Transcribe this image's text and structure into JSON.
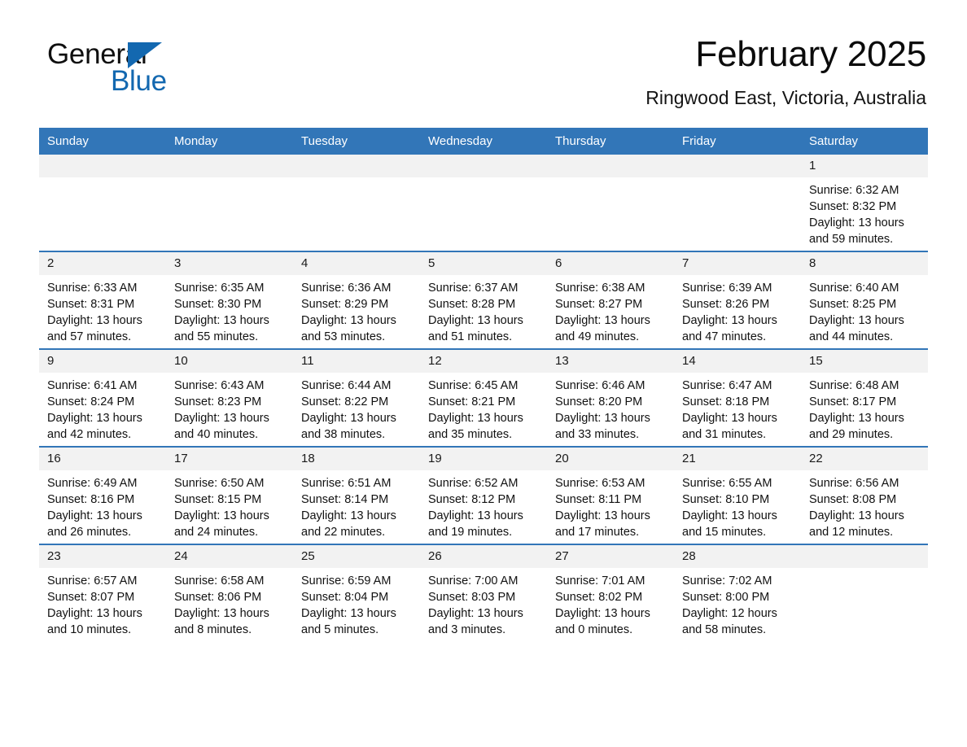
{
  "brand": {
    "name_line1": "General",
    "name_line2": "Blue",
    "colors": {
      "blue": "#1368b0",
      "black": "#0f0f0f"
    }
  },
  "header": {
    "title": "February 2025",
    "subtitle": "Ringwood East, Victoria, Australia"
  },
  "theme": {
    "header_blue": "#3276b8",
    "day_band_gray": "#f2f2f2",
    "row_rule_blue": "#3276b8",
    "text_black": "#111111",
    "page_background": "#ffffff"
  },
  "calendar": {
    "weekday_headers": [
      "Sunday",
      "Monday",
      "Tuesday",
      "Wednesday",
      "Thursday",
      "Friday",
      "Saturday"
    ],
    "weeks": [
      [
        {
          "day": "",
          "detail": ""
        },
        {
          "day": "",
          "detail": ""
        },
        {
          "day": "",
          "detail": ""
        },
        {
          "day": "",
          "detail": ""
        },
        {
          "day": "",
          "detail": ""
        },
        {
          "day": "",
          "detail": ""
        },
        {
          "day": "1",
          "detail": "Sunrise: 6:32 AM\nSunset: 8:32 PM\nDaylight: 13 hours and 59 minutes."
        }
      ],
      [
        {
          "day": "2",
          "detail": "Sunrise: 6:33 AM\nSunset: 8:31 PM\nDaylight: 13 hours and 57 minutes."
        },
        {
          "day": "3",
          "detail": "Sunrise: 6:35 AM\nSunset: 8:30 PM\nDaylight: 13 hours and 55 minutes."
        },
        {
          "day": "4",
          "detail": "Sunrise: 6:36 AM\nSunset: 8:29 PM\nDaylight: 13 hours and 53 minutes."
        },
        {
          "day": "5",
          "detail": "Sunrise: 6:37 AM\nSunset: 8:28 PM\nDaylight: 13 hours and 51 minutes."
        },
        {
          "day": "6",
          "detail": "Sunrise: 6:38 AM\nSunset: 8:27 PM\nDaylight: 13 hours and 49 minutes."
        },
        {
          "day": "7",
          "detail": "Sunrise: 6:39 AM\nSunset: 8:26 PM\nDaylight: 13 hours and 47 minutes."
        },
        {
          "day": "8",
          "detail": "Sunrise: 6:40 AM\nSunset: 8:25 PM\nDaylight: 13 hours and 44 minutes."
        }
      ],
      [
        {
          "day": "9",
          "detail": "Sunrise: 6:41 AM\nSunset: 8:24 PM\nDaylight: 13 hours and 42 minutes."
        },
        {
          "day": "10",
          "detail": "Sunrise: 6:43 AM\nSunset: 8:23 PM\nDaylight: 13 hours and 40 minutes."
        },
        {
          "day": "11",
          "detail": "Sunrise: 6:44 AM\nSunset: 8:22 PM\nDaylight: 13 hours and 38 minutes."
        },
        {
          "day": "12",
          "detail": "Sunrise: 6:45 AM\nSunset: 8:21 PM\nDaylight: 13 hours and 35 minutes."
        },
        {
          "day": "13",
          "detail": "Sunrise: 6:46 AM\nSunset: 8:20 PM\nDaylight: 13 hours and 33 minutes."
        },
        {
          "day": "14",
          "detail": "Sunrise: 6:47 AM\nSunset: 8:18 PM\nDaylight: 13 hours and 31 minutes."
        },
        {
          "day": "15",
          "detail": "Sunrise: 6:48 AM\nSunset: 8:17 PM\nDaylight: 13 hours and 29 minutes."
        }
      ],
      [
        {
          "day": "16",
          "detail": "Sunrise: 6:49 AM\nSunset: 8:16 PM\nDaylight: 13 hours and 26 minutes."
        },
        {
          "day": "17",
          "detail": "Sunrise: 6:50 AM\nSunset: 8:15 PM\nDaylight: 13 hours and 24 minutes."
        },
        {
          "day": "18",
          "detail": "Sunrise: 6:51 AM\nSunset: 8:14 PM\nDaylight: 13 hours and 22 minutes."
        },
        {
          "day": "19",
          "detail": "Sunrise: 6:52 AM\nSunset: 8:12 PM\nDaylight: 13 hours and 19 minutes."
        },
        {
          "day": "20",
          "detail": "Sunrise: 6:53 AM\nSunset: 8:11 PM\nDaylight: 13 hours and 17 minutes."
        },
        {
          "day": "21",
          "detail": "Sunrise: 6:55 AM\nSunset: 8:10 PM\nDaylight: 13 hours and 15 minutes."
        },
        {
          "day": "22",
          "detail": "Sunrise: 6:56 AM\nSunset: 8:08 PM\nDaylight: 13 hours and 12 minutes."
        }
      ],
      [
        {
          "day": "23",
          "detail": "Sunrise: 6:57 AM\nSunset: 8:07 PM\nDaylight: 13 hours and 10 minutes."
        },
        {
          "day": "24",
          "detail": "Sunrise: 6:58 AM\nSunset: 8:06 PM\nDaylight: 13 hours and 8 minutes."
        },
        {
          "day": "25",
          "detail": "Sunrise: 6:59 AM\nSunset: 8:04 PM\nDaylight: 13 hours and 5 minutes."
        },
        {
          "day": "26",
          "detail": "Sunrise: 7:00 AM\nSunset: 8:03 PM\nDaylight: 13 hours and 3 minutes."
        },
        {
          "day": "27",
          "detail": "Sunrise: 7:01 AM\nSunset: 8:02 PM\nDaylight: 13 hours and 0 minutes."
        },
        {
          "day": "28",
          "detail": "Sunrise: 7:02 AM\nSunset: 8:00 PM\nDaylight: 12 hours and 58 minutes."
        },
        {
          "day": "",
          "detail": ""
        }
      ]
    ]
  }
}
